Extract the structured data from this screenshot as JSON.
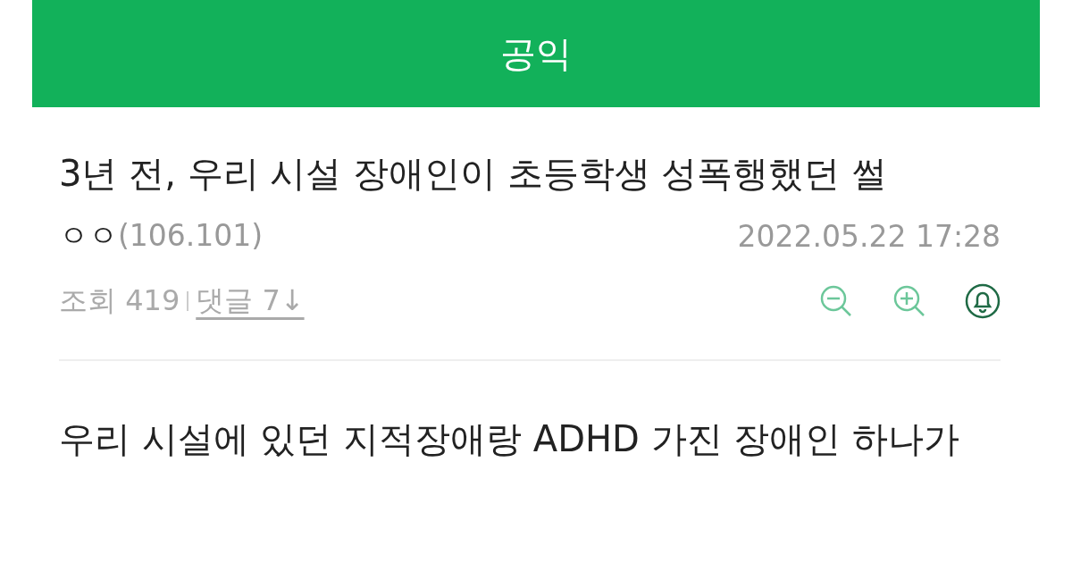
{
  "header": {
    "title": "공익"
  },
  "post": {
    "title": "3년 전, 우리 시설 장애인이 초등학생 성폭행했던 썰",
    "author": "ㅇㅇ",
    "ip": "(106.101)",
    "date": "2022.05.22 17:28",
    "views": "조회 419",
    "comments_link": "댓글 7↓"
  },
  "body": {
    "text": "우리 시설에 있던 지적장애랑 ADHD 가진 장애인 하나가"
  }
}
